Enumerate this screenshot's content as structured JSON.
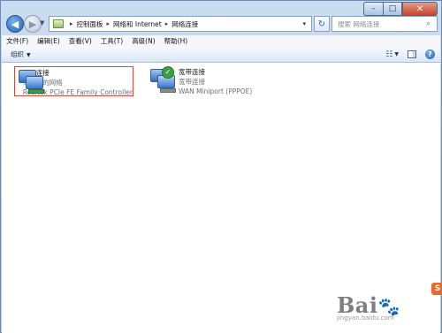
{
  "window": {
    "caption_buttons": {
      "minimize": "–",
      "maximize": "□",
      "close": "✕"
    }
  },
  "address_bar": {
    "path": [
      "控制面板",
      "网络和 Internet",
      "网络连接"
    ],
    "dropdown_glyph": "▾",
    "refresh_glyph": "↻"
  },
  "search": {
    "placeholder": "搜索 网络连接"
  },
  "menu": {
    "items": [
      "文件(F)",
      "编辑(E)",
      "查看(V)",
      "工具(T)",
      "高级(N)",
      "帮助(H)"
    ]
  },
  "command_bar": {
    "organize_label": "组织",
    "help_glyph": "?"
  },
  "connections": [
    {
      "name": "本地连接",
      "status": "未识别的网络",
      "device": "Realtek PCIe FE Family Controller",
      "icon": "network-adapter-icon",
      "selected": true
    },
    {
      "name": "宽带连接",
      "status": "宽带连接",
      "device": "WAN Miniport (PPPOE)",
      "icon": "broadband-connection-icon",
      "connected_badge": "✓"
    }
  ],
  "watermark": {
    "logo": "Bai",
    "logo_paw": "🐾",
    "url": "jingyan.baidu.com",
    "badge": "S"
  },
  "colors": {
    "selection_border": "#d44a3c",
    "title_gradient_top": "#c9dcf2",
    "close_button": "#c4452c"
  }
}
